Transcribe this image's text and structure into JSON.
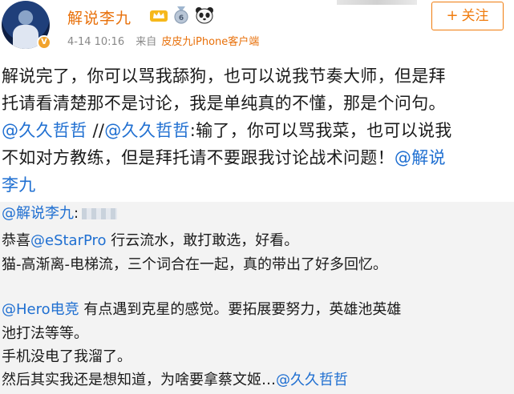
{
  "post": {
    "username": "解说李九",
    "timestamp": "4-14 10:16",
    "from_label": "来自",
    "source": "皮皮九iPhone客户端",
    "follow_label": "关注",
    "body": [
      [
        {
          "t": "解说完了，你可以骂我舔狗，也可以说我节奏大师，但是拜"
        }
      ],
      [
        {
          "t": "托请看清楚那不是讨论，我是单纯真的不懂，那是个问句。"
        }
      ],
      [
        {
          "t": "@久久哲哲",
          "m": true
        },
        {
          "t": " //"
        },
        {
          "t": "@久久哲哲",
          "m": true
        },
        {
          "t": ":输了，你可以骂我菜，也可以说我"
        }
      ],
      [
        {
          "t": "不如对方教练，但是拜托请不要跟我讨论战术问题！"
        },
        {
          "t": "@解说",
          "m": true
        }
      ],
      [
        {
          "t": "李九",
          "m": true
        }
      ]
    ]
  },
  "repost": {
    "mention_user": "@解说李九",
    "sep": ":",
    "comments": [
      [
        {
          "t": "恭喜"
        },
        {
          "t": "@eStarPro",
          "m": true
        },
        {
          "t": " 行云流水，敢打敢选，好看。"
        }
      ],
      [
        {
          "t": "猫-高渐离-电梯流，三个词合在一起，真的带出了好多回忆。"
        }
      ],
      [
        {
          "t": "@Hero电竞",
          "m": true
        },
        {
          "t": " 有点遇到克星的感觉。要拓展要努力，英雄池英雄"
        }
      ],
      [
        {
          "t": "池打法等等。"
        }
      ],
      [
        {
          "t": "手机没电了我溜了。"
        }
      ],
      [
        {
          "t": "然后其实我还是想知道，为啥要拿蔡文姬…"
        },
        {
          "t": "@久久哲哲",
          "m": true
        }
      ]
    ]
  },
  "colors": {
    "username": "#e8700a",
    "mention": "#1f6fd1",
    "follow": "#f07c0e",
    "repost_bg": "#f3f3f3"
  },
  "icons": [
    "crown-icon",
    "medal-icon",
    "panda-icon",
    "plus-icon"
  ]
}
